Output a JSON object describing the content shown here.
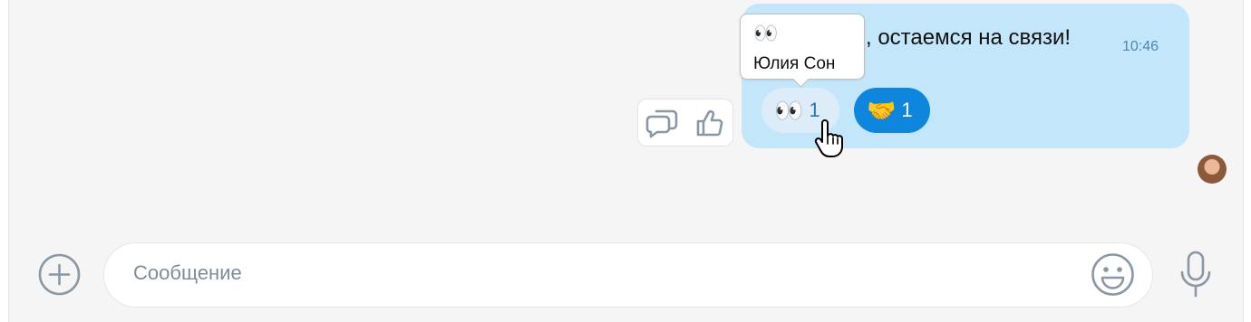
{
  "message": {
    "text_visible": ", остаемся на связи!",
    "time": "10:46",
    "reactions": [
      {
        "emoji": "👀",
        "count": "1",
        "selected": false
      },
      {
        "emoji": "🤝",
        "count": "1",
        "selected": true
      }
    ]
  },
  "tooltip": {
    "emoji": "👀",
    "name": "Юлия Сон"
  },
  "composer": {
    "placeholder": "Сообщение"
  },
  "colors": {
    "bubble": "#c4e6fb",
    "accent": "#0e86de",
    "background": "#f5f5f5"
  },
  "icons": {
    "reply": "reply-icon",
    "like": "thumbs-up-icon",
    "add": "add-icon",
    "emoji": "smile-icon",
    "mic": "microphone-icon",
    "cursor": "hand-cursor-icon"
  }
}
